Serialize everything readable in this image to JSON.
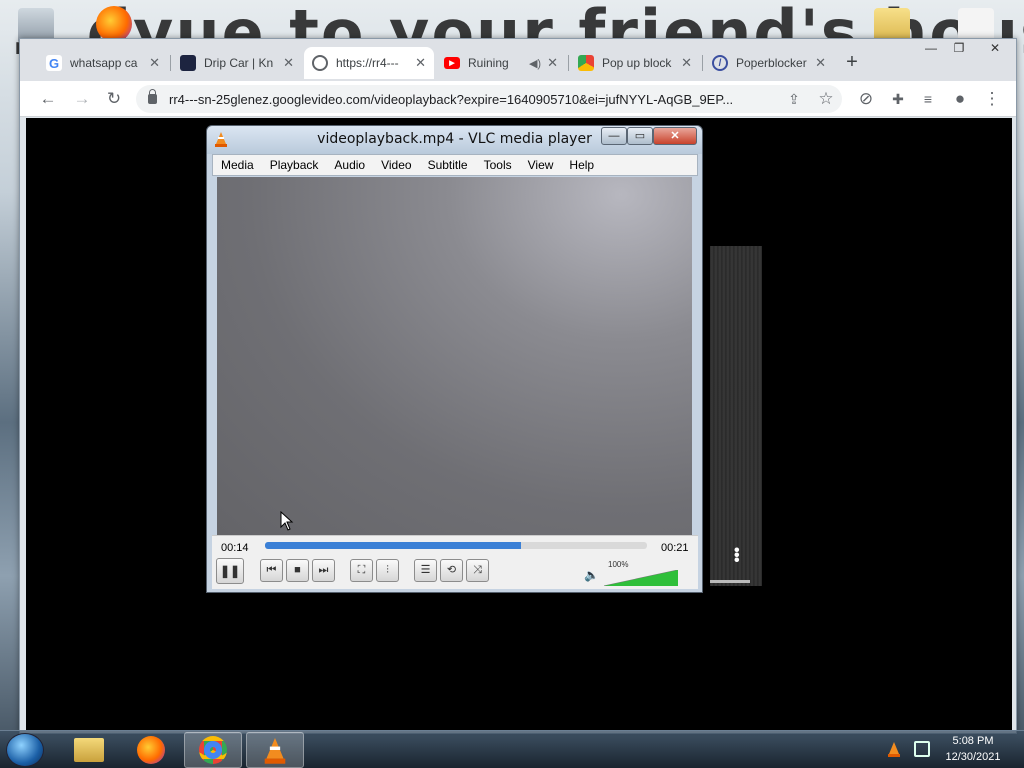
{
  "desktop": {
    "background_text": "...dyue to your friend's house w..."
  },
  "browser": {
    "tabs": [
      {
        "title": "whatsapp ca",
        "icon": "google-icon"
      },
      {
        "title": "Drip Car | Kn",
        "icon": "site-favicon"
      },
      {
        "title": "https://rr4---",
        "icon": "globe-icon"
      },
      {
        "title": "Ruining",
        "icon": "youtube-icon"
      },
      {
        "title": "Pop up block",
        "icon": "chrome-store-icon"
      },
      {
        "title": "Poperblocker",
        "icon": "block-icon"
      }
    ],
    "url": "rr4---sn-25glenez.googlevideo.com/videoplayback?expire=1640905710&ei=jufNYYL-AqGB_9EP..."
  },
  "vlc": {
    "title": "videoplayback.mp4 - VLC media player",
    "menu": [
      "Media",
      "Playback",
      "Audio",
      "Video",
      "Subtitle",
      "Tools",
      "View",
      "Help"
    ],
    "time_current": "00:14",
    "time_total": "00:21",
    "progress": 0.67,
    "volume_label": "100%",
    "volume": 1.0
  },
  "taskbar": {
    "time": "5:08 PM",
    "date": "12/30/2021"
  },
  "colors": {
    "seek_fill": "#3b80d6",
    "volume_fill": "#2fbf3a",
    "vlc_close": "#c8422c"
  }
}
